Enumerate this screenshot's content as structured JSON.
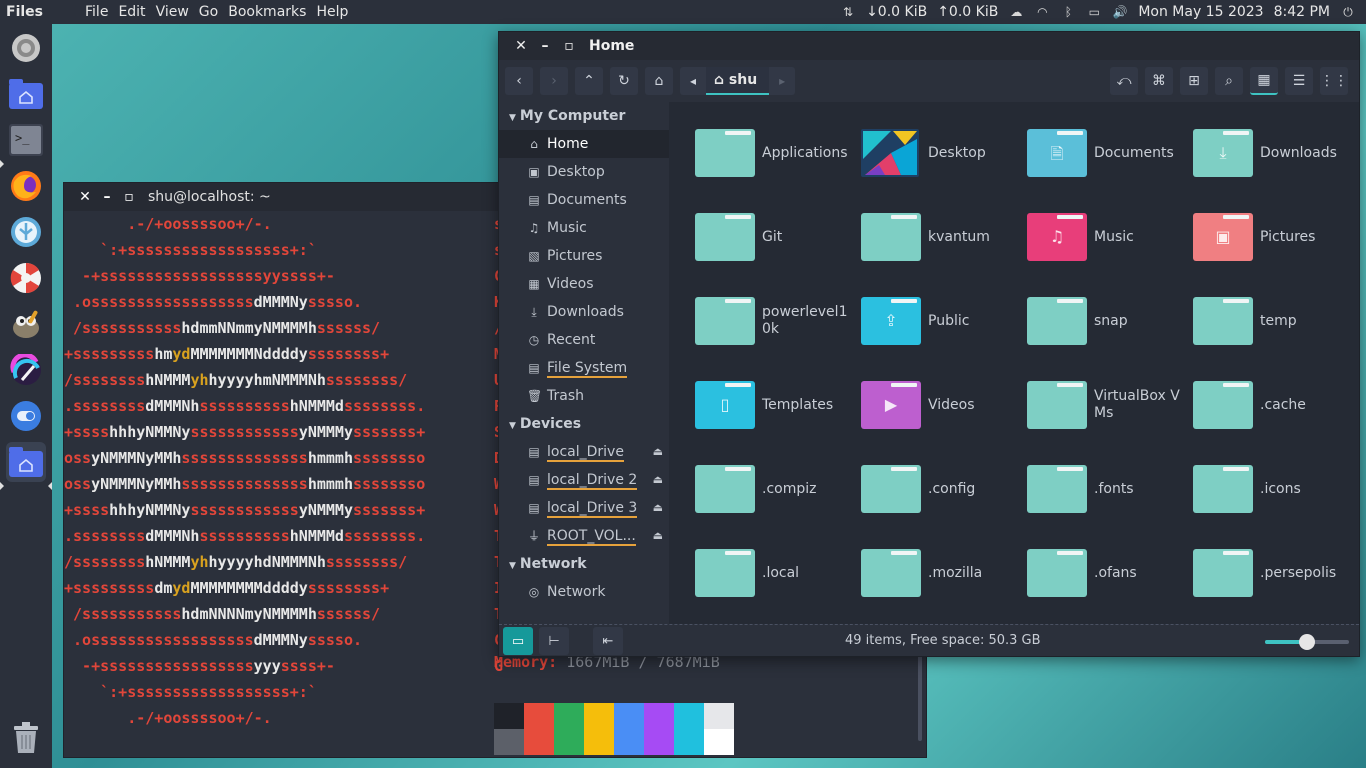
{
  "top_panel": {
    "app_name": "Files",
    "menu": [
      "File",
      "Edit",
      "View",
      "Go",
      "Bookmarks",
      "Help"
    ],
    "net_down": "↓0.0 KiB",
    "net_up": "↑0.0 KiB",
    "date": "Mon May 15 2023",
    "time": "8:42 PM"
  },
  "dock": {
    "items": [
      "system-settings-icon",
      "home-folder-icon",
      "terminal-icon",
      "firefox-icon",
      "app-icon",
      "app-icon",
      "gimp-icon",
      "krita-icon",
      "toggle-icon",
      "files-icon",
      "trash-icon"
    ]
  },
  "terminal": {
    "title": "shu@localhost: ~",
    "art": [
      [
        [
          "r",
          "       .-/+oossssoo+/-.       "
        ]
      ],
      [
        [
          "r",
          "    `:+ssssssssssssssssss+:`    "
        ]
      ],
      [
        [
          "r",
          "  -+ssssssssssssssssssyyssss+-  "
        ]
      ],
      [
        [
          "r",
          " .ossssssssssssssssss"
        ],
        [
          "w",
          "dMMMNy"
        ],
        [
          "r",
          "sssso. "
        ]
      ],
      [
        [
          "r",
          " /sssssssssss"
        ],
        [
          "w",
          "hdmmNNmmyNMMMMh"
        ],
        [
          "r",
          "ssssss/ "
        ]
      ],
      [
        [
          "r",
          "+sssssssss"
        ],
        [
          "w",
          "hm"
        ],
        [
          "y",
          "yd"
        ],
        [
          "w",
          "MMMMMMMNddddy"
        ],
        [
          "r",
          "ssssssss+"
        ]
      ],
      [
        [
          "r",
          "/ssssssss"
        ],
        [
          "w",
          "hNMMM"
        ],
        [
          "y",
          "yh"
        ],
        [
          "w",
          "hyyyyhmNMMMNh"
        ],
        [
          "r",
          "ssssssss/"
        ]
      ],
      [
        [
          "r",
          ".ssssssss"
        ],
        [
          "w",
          "dMMMNh"
        ],
        [
          "r",
          "ssssssssss"
        ],
        [
          "w",
          "hNMMMd"
        ],
        [
          "r",
          "ssssssss."
        ]
      ],
      [
        [
          "r",
          "+ssss"
        ],
        [
          "w",
          "hhhyNMMNy"
        ],
        [
          "r",
          "ssssssssssss"
        ],
        [
          "w",
          "yNMMMy"
        ],
        [
          "r",
          "sssssss+"
        ]
      ],
      [
        [
          "r",
          "oss"
        ],
        [
          "w",
          "yNMMMNyMMh"
        ],
        [
          "r",
          "ssssssssssssss"
        ],
        [
          "w",
          "hmmmh"
        ],
        [
          "r",
          "ssssssso"
        ]
      ],
      [
        [
          "r",
          "oss"
        ],
        [
          "w",
          "yNMMMNyMMh"
        ],
        [
          "r",
          "ssssssssssssss"
        ],
        [
          "w",
          "hmmmh"
        ],
        [
          "r",
          "ssssssso"
        ]
      ],
      [
        [
          "r",
          "+ssss"
        ],
        [
          "w",
          "hhhyNMMNy"
        ],
        [
          "r",
          "ssssssssssss"
        ],
        [
          "w",
          "yNMMMy"
        ],
        [
          "r",
          "sssssss+"
        ]
      ],
      [
        [
          "r",
          ".ssssssss"
        ],
        [
          "w",
          "dMMMNh"
        ],
        [
          "r",
          "ssssssssss"
        ],
        [
          "w",
          "hNMMMd"
        ],
        [
          "r",
          "ssssssss."
        ]
      ],
      [
        [
          "r",
          "/ssssssss"
        ],
        [
          "w",
          "hNMMM"
        ],
        [
          "y",
          "yh"
        ],
        [
          "w",
          "hyyyyhdNMMMNh"
        ],
        [
          "r",
          "ssssssss/"
        ]
      ],
      [
        [
          "r",
          "+sssssssss"
        ],
        [
          "w",
          "dm"
        ],
        [
          "y",
          "yd"
        ],
        [
          "w",
          "MMMMMMMMddddy"
        ],
        [
          "r",
          "ssssssss+"
        ]
      ],
      [
        [
          "r",
          " /sssssssssss"
        ],
        [
          "w",
          "hdmNNNNmyNMMMMh"
        ],
        [
          "r",
          "ssssss/ "
        ]
      ],
      [
        [
          "r",
          " .ossssssssssssssssss"
        ],
        [
          "w",
          "dMMMNy"
        ],
        [
          "r",
          "sssso. "
        ]
      ],
      [
        [
          "r",
          "  -+sssssssssssssssss"
        ],
        [
          "w",
          "yyy"
        ],
        [
          "r",
          "ssss+-  "
        ]
      ],
      [
        [
          "r",
          "    `:+ssssssssssssssssss+:`    "
        ]
      ],
      [
        [
          "r",
          "       .-/+oossssoo+/-.       "
        ]
      ]
    ],
    "right_column": [
      "s",
      "s",
      "C",
      "K",
      "/",
      "M",
      "U",
      "P",
      "S",
      "D",
      "W",
      "W",
      "T",
      "T",
      "I",
      "T",
      "C",
      "G"
    ],
    "memory_key": "Memory:",
    "memory_value": " 1667MiB / 7687MiB",
    "swatch_colors_top": [
      "#1f2229",
      "#e74c3c",
      "#2eac5a",
      "#f5be0b",
      "#4a8ef5",
      "#a64bf4",
      "#20c0de",
      "#e6e7ea"
    ],
    "swatch_colors_bottom": [
      "#5c6069",
      "#e74c3c",
      "#2eac5a",
      "#f5be0b",
      "#4a8ef5",
      "#a64bf4",
      "#20c0de",
      "#ffffff"
    ]
  },
  "file_manager": {
    "title": "Home",
    "breadcrumb": "shu",
    "sidebar": {
      "sections": [
        {
          "label": "My Computer",
          "items": [
            {
              "label": "Home",
              "icon": "home-icon",
              "active": true
            },
            {
              "label": "Desktop",
              "icon": "desktop-icon"
            },
            {
              "label": "Documents",
              "icon": "documents-icon"
            },
            {
              "label": "Music",
              "icon": "music-icon"
            },
            {
              "label": "Pictures",
              "icon": "pictures-icon"
            },
            {
              "label": "Videos",
              "icon": "videos-icon"
            },
            {
              "label": "Downloads",
              "icon": "downloads-icon"
            },
            {
              "label": "Recent",
              "icon": "recent-icon"
            },
            {
              "label": "File System",
              "icon": "drive-icon",
              "underline": true
            },
            {
              "label": "Trash",
              "icon": "trash-icon"
            }
          ]
        },
        {
          "label": "Devices",
          "items": [
            {
              "label": "local_Drive",
              "icon": "drive-icon",
              "underline": true,
              "eject": true
            },
            {
              "label": "local_Drive 2",
              "icon": "drive-icon",
              "underline": true,
              "eject": true
            },
            {
              "label": "local_Drive 3",
              "icon": "drive-icon",
              "underline": true,
              "eject": true
            },
            {
              "label": "ROOT_VOL...",
              "icon": "usb-icon",
              "underline": true,
              "eject": true
            }
          ]
        },
        {
          "label": "Network",
          "items": [
            {
              "label": "Network",
              "icon": "network-icon"
            }
          ]
        }
      ]
    },
    "items": [
      {
        "label": "Applications",
        "color": "#7ecfc4"
      },
      {
        "label": "Desktop",
        "color": "special-desktop"
      },
      {
        "label": "Documents",
        "color": "#5bbfd9",
        "glyph": "🗎"
      },
      {
        "label": "Downloads",
        "color": "#7ecfc4",
        "glyph": "⤓"
      },
      {
        "label": "Git",
        "color": "#7ecfc4"
      },
      {
        "label": "kvantum",
        "color": "#7ecfc4"
      },
      {
        "label": "Music",
        "color": "#e83e7a",
        "glyph": "♫"
      },
      {
        "label": "Pictures",
        "color": "#f07f82",
        "glyph": "▣"
      },
      {
        "label": "powerlevel10k",
        "color": "#7ecfc4"
      },
      {
        "label": "Public",
        "color": "#2bc0e0",
        "glyph": "⇪"
      },
      {
        "label": "snap",
        "color": "#7ecfc4"
      },
      {
        "label": "temp",
        "color": "#7ecfc4"
      },
      {
        "label": "Templates",
        "color": "#2bc0e0",
        "glyph": "▯"
      },
      {
        "label": "Videos",
        "color": "#bd5fcf",
        "glyph": "▶"
      },
      {
        "label": "VirtualBox VMs",
        "color": "#7ecfc4"
      },
      {
        "label": ".cache",
        "color": "#7ecfc4"
      },
      {
        "label": ".compiz",
        "color": "#7ecfc4"
      },
      {
        "label": ".config",
        "color": "#7ecfc4"
      },
      {
        "label": ".fonts",
        "color": "#7ecfc4"
      },
      {
        "label": ".icons",
        "color": "#7ecfc4"
      },
      {
        "label": ".local",
        "color": "#7ecfc4"
      },
      {
        "label": ".mozilla",
        "color": "#7ecfc4"
      },
      {
        "label": ".ofans",
        "color": "#7ecfc4"
      },
      {
        "label": ".persepolis",
        "color": "#7ecfc4"
      }
    ],
    "status_text": "49 items, Free space: 50.3 GB",
    "zoom_level": 0.5,
    "accent": "#3ec3c2"
  }
}
